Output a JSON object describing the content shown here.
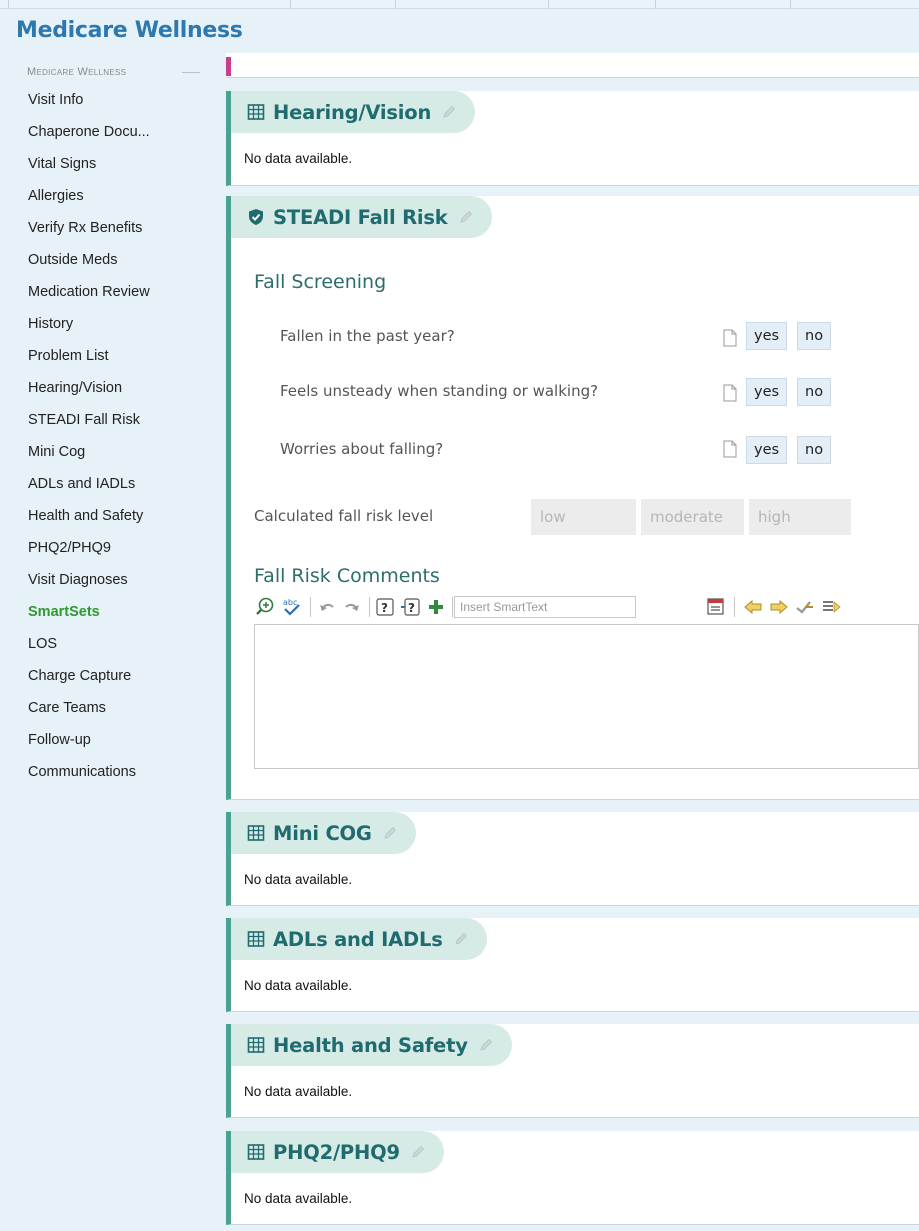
{
  "page": {
    "title": "Medicare Wellness"
  },
  "sidebar": {
    "header": "Medicare Wellness",
    "items": [
      {
        "label": "Visit Info"
      },
      {
        "label": "Chaperone Docu..."
      },
      {
        "label": "Vital Signs"
      },
      {
        "label": "Allergies"
      },
      {
        "label": "Verify Rx Benefits"
      },
      {
        "label": "Outside Meds"
      },
      {
        "label": "Medication Review"
      },
      {
        "label": "History"
      },
      {
        "label": "Problem List"
      },
      {
        "label": "Hearing/Vision"
      },
      {
        "label": "STEADI Fall Risk"
      },
      {
        "label": "Mini Cog"
      },
      {
        "label": "ADLs and IADLs"
      },
      {
        "label": "Health and Safety"
      },
      {
        "label": "PHQ2/PHQ9"
      },
      {
        "label": "Visit Diagnoses"
      },
      {
        "label": "SmartSets",
        "active": true
      },
      {
        "label": "LOS"
      },
      {
        "label": "Charge Capture"
      },
      {
        "label": "Care Teams"
      },
      {
        "label": "Follow-up"
      },
      {
        "label": "Communications"
      }
    ]
  },
  "sections": {
    "hearing_vision": {
      "title": "Hearing/Vision",
      "body": "No data available."
    },
    "steadi": {
      "title": "STEADI Fall Risk",
      "subtitle": "Fall Screening",
      "questions": [
        {
          "text": "Fallen in the past year?",
          "yes": "yes",
          "no": "no"
        },
        {
          "text": "Feels unsteady when standing or walking?",
          "yes": "yes",
          "no": "no"
        },
        {
          "text": "Worries about falling?",
          "yes": "yes",
          "no": "no"
        }
      ],
      "calc_label": "Calculated fall risk level",
      "risk_levels": [
        "low",
        "moderate",
        "high"
      ],
      "comments_title": "Fall Risk Comments",
      "smarttext_placeholder": "Insert SmartText"
    },
    "mini_cog": {
      "title": "Mini COG",
      "body": "No data available."
    },
    "adls": {
      "title": "ADLs and IADLs",
      "body": "No data available."
    },
    "health_safety": {
      "title": "Health and Safety",
      "body": "No data available."
    },
    "phq": {
      "title": "PHQ2/PHQ9",
      "body": "No data available."
    }
  },
  "colors": {
    "accent_teal": "#4aa392",
    "title_blue": "#2e78b0",
    "active_green": "#2e9a2e",
    "marker_pink": "#cc3d8e"
  }
}
